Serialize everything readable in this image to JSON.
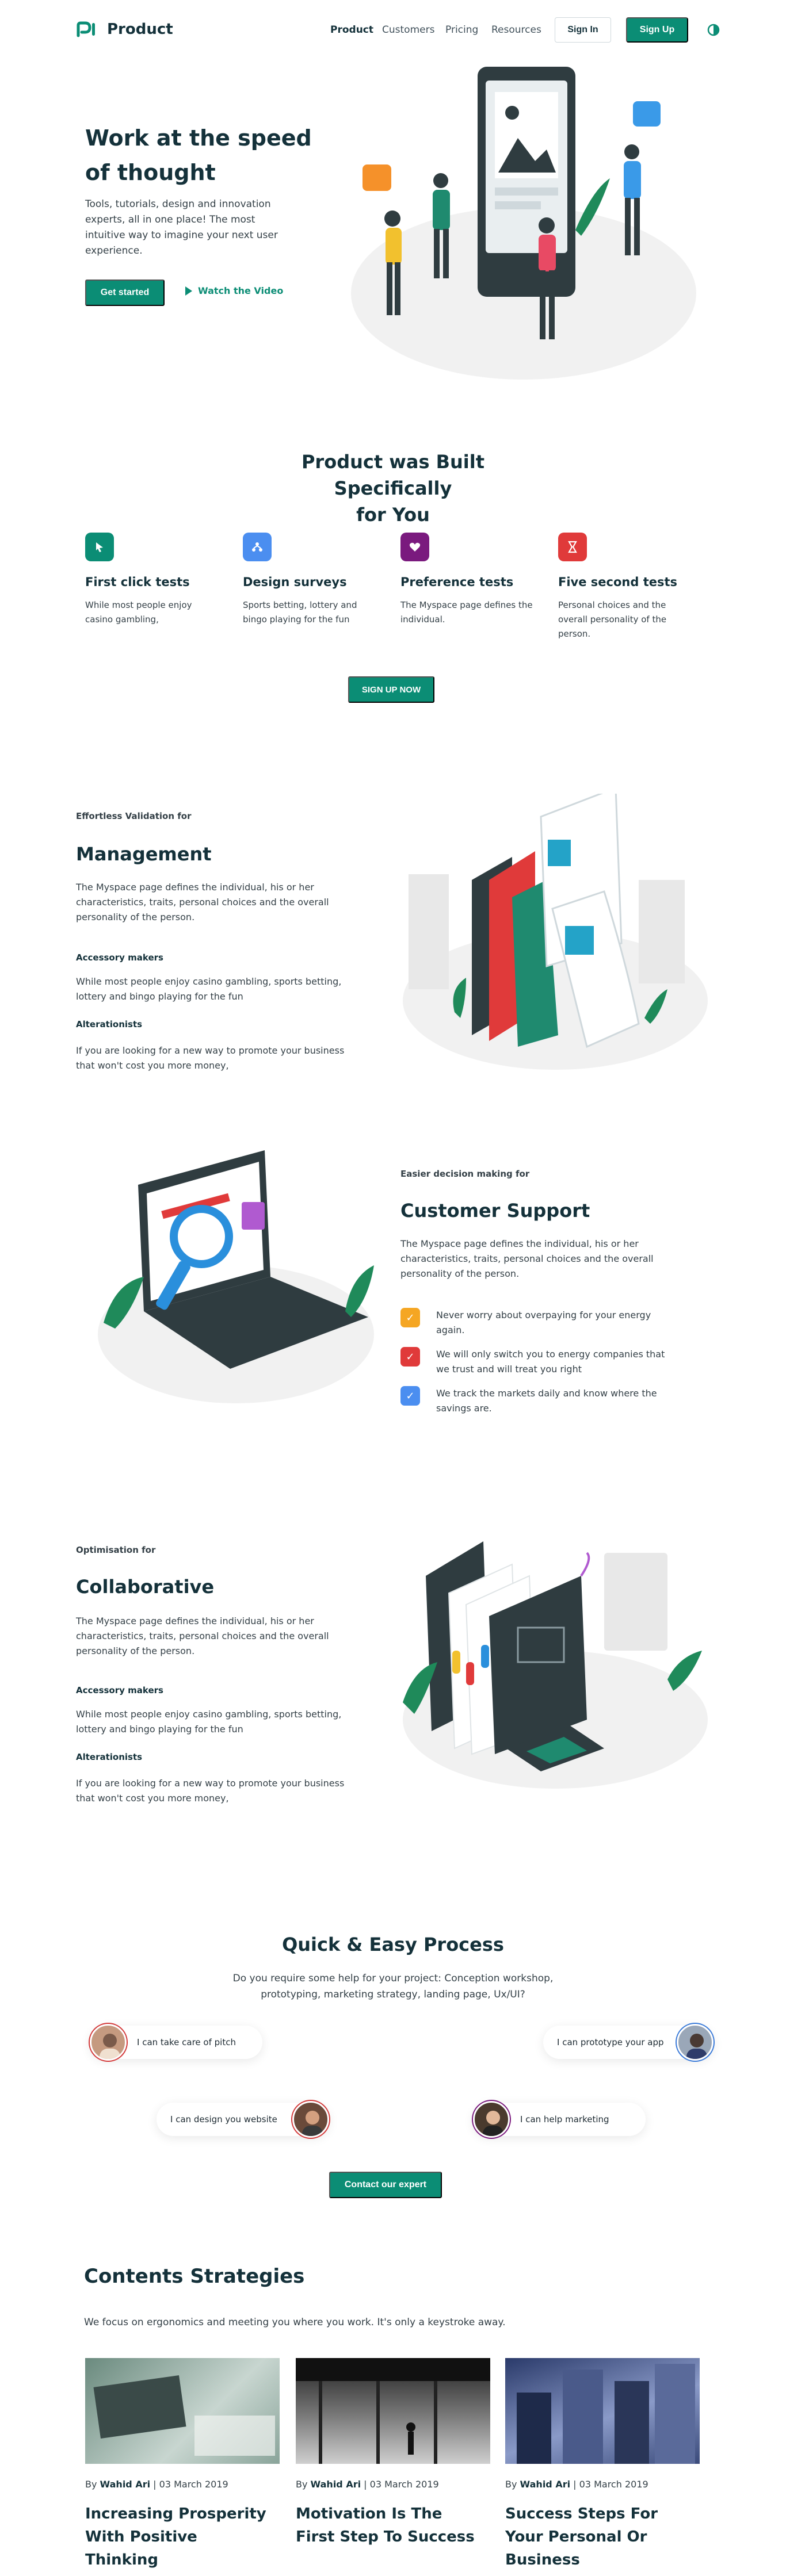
{
  "nav": {
    "brand": "Product",
    "links": [
      "Product",
      "Customers",
      "Pricing",
      "Resources"
    ],
    "signin": "Sign In",
    "signup": "Sign Up",
    "theme_icon": "contrast-icon"
  },
  "hero": {
    "title_line1": "Work at the speed",
    "title_line2": "of thought",
    "subtitle": "Tools, tutorials, design and innovation experts, all in one place! The most intuitive way to imagine your next user experience.",
    "cta_primary": "Get started",
    "cta_secondary": "Watch the Video"
  },
  "features": {
    "title_line1": "Product was Built Specifically",
    "title_line2": "for You",
    "items": [
      {
        "title": "First click tests",
        "desc": "While most people enjoy casino gambling,",
        "icon": "cursor-icon",
        "color": "#0b8d75"
      },
      {
        "title": "Design surveys",
        "desc": "Sports betting, lottery and bingo playing for the fun",
        "icon": "network-icon",
        "color": "#4b8ef0"
      },
      {
        "title": "Preference tests",
        "desc": "The Myspace page defines the individual.",
        "icon": "heart-icon",
        "color": "#7a1a7e"
      },
      {
        "title": "Five second tests",
        "desc": "Personal choices and the overall personality of the person.",
        "icon": "hourglass-icon",
        "color": "#e03a3a"
      }
    ],
    "cta": "SIGN UP NOW"
  },
  "management": {
    "eyebrow": "Effortless Validation for",
    "title": "Management",
    "desc": "The Myspace page defines the individual, his or her characteristics, traits, personal choices and the overall personality of the person.",
    "sub1_head": "Accessory makers",
    "sub1_desc": "While most people enjoy casino gambling, sports betting, lottery and bingo playing for the fun",
    "sub2_head": "Alterationists",
    "sub2_desc": "If you are looking for a new way to promote your business that won't cost you more money,"
  },
  "support": {
    "eyebrow": "Easier decision making for",
    "title": "Customer Support",
    "desc": "The Myspace page defines the individual, his or her characteristics, traits, personal choices and the overall personality of the person.",
    "checks": [
      {
        "text": "Never worry about overpaying for your energy again.",
        "color": "#f5a623"
      },
      {
        "text": "We will only switch you to energy companies that we trust and will treat you right",
        "color": "#e03a3a"
      },
      {
        "text": "We track the markets daily and know where the savings are.",
        "color": "#4b8ef0"
      }
    ]
  },
  "collaborative": {
    "eyebrow": "Optimisation for",
    "title": "Collaborative",
    "desc": "The Myspace page defines the individual, his or her characteristics, traits, personal choices and the overall personality of the person.",
    "sub1_head": "Accessory makers",
    "sub1_desc": "While most people enjoy casino gambling, sports betting, lottery and bingo playing for the fun",
    "sub2_head": "Alterationists",
    "sub2_desc": "If you are looking for a new way to promote your business that won't cost you more money,"
  },
  "process": {
    "title": "Quick & Easy Process",
    "subtitle": "Do you require some help for your project: Conception workshop, prototyping, marketing strategy, landing page, Ux/UI?",
    "chips": [
      "I can take care of pitch",
      "I can prototype your app",
      "I can design you website",
      "I can help marketing"
    ],
    "cta": "Contact our expert"
  },
  "blog": {
    "title": "Contents Strategies",
    "subtitle": "We focus on ergonomics and meeting you where you work. It's only a keystroke away.",
    "cards": [
      {
        "by": "By",
        "author": "Wahid Ari",
        "date": "| 03 March 2019",
        "title": "Increasing Prosperity With Positive Thinking"
      },
      {
        "by": "By",
        "author": "Wahid Ari",
        "date": "| 03 March 2019",
        "title": "Motivation Is The First Step To Success"
      },
      {
        "by": "By",
        "author": "Wahid Ari",
        "date": "| 03 March 2019",
        "title": "Success Steps For Your Personal Or Business"
      }
    ]
  },
  "colors": {
    "brand": "#0b8d75",
    "dark": "#14313a"
  }
}
